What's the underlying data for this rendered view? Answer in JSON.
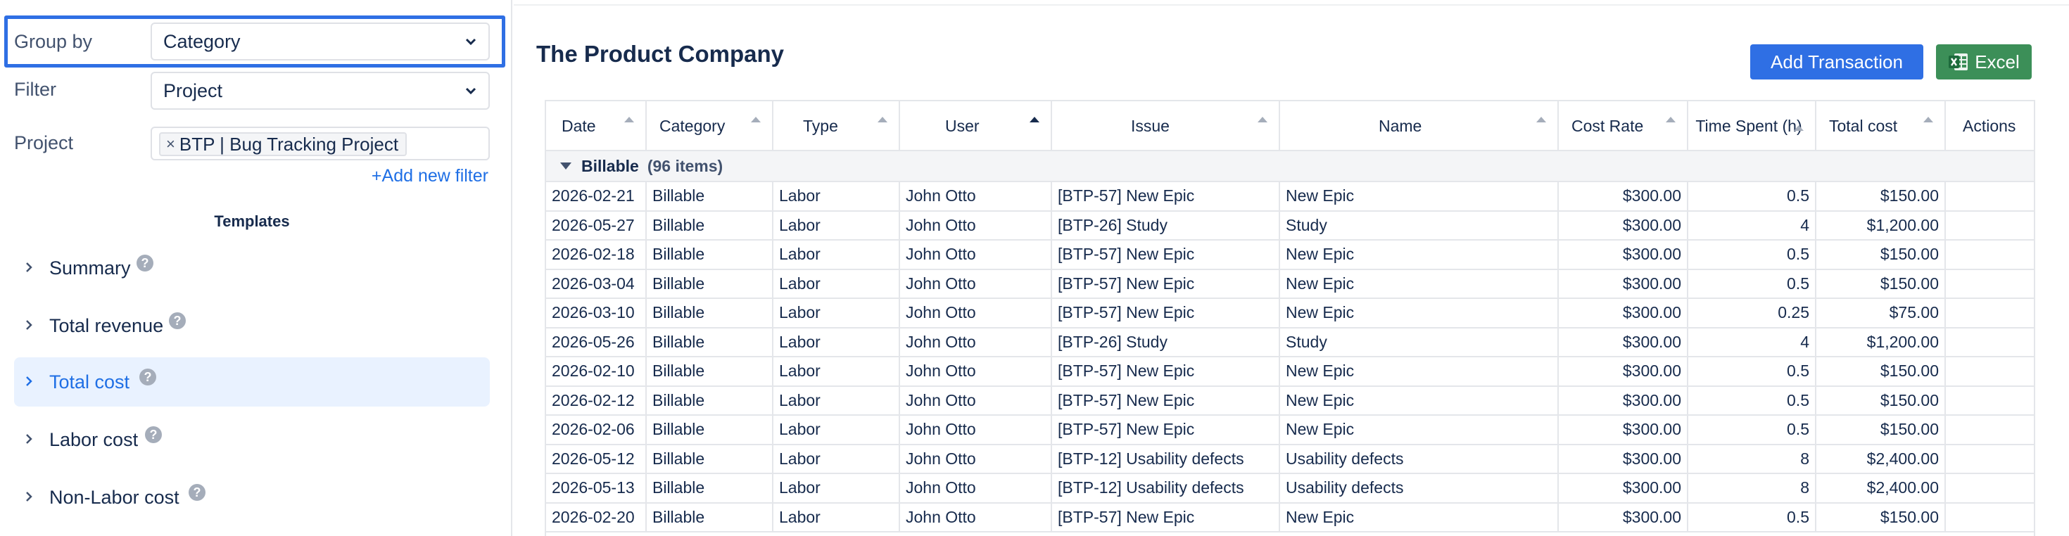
{
  "left": {
    "group_by": {
      "label": "Group by",
      "value": "Category"
    },
    "filter": {
      "label": "Filter",
      "value": "Project"
    },
    "project": {
      "label": "Project",
      "chip_remove": "×",
      "chip": "BTP | Bug Tracking Project"
    },
    "add_filter": "+Add new filter",
    "templates_title": "Templates",
    "templates": [
      {
        "label": "Summary",
        "active": false
      },
      {
        "label": "Total revenue",
        "active": false
      },
      {
        "label": "Total cost",
        "active": true
      },
      {
        "label": "Labor cost",
        "active": false
      },
      {
        "label": "Non-Labor cost",
        "active": false
      }
    ],
    "help_glyph": "?"
  },
  "right": {
    "company": "The Product Company",
    "add_button": "Add Transaction",
    "excel_button": "Excel",
    "columns": [
      {
        "label": "Date"
      },
      {
        "label": "Category"
      },
      {
        "label": "Type"
      },
      {
        "label": "User"
      },
      {
        "label": "Issue"
      },
      {
        "label": "Name"
      },
      {
        "label": "Cost Rate"
      },
      {
        "label": "Time Spent (h)"
      },
      {
        "label": "Total cost"
      },
      {
        "label": "Actions"
      }
    ],
    "group": {
      "name": "Billable",
      "count": "(96 items)"
    },
    "rows": [
      [
        "2026-02-21",
        "Billable",
        "Labor",
        "John Otto",
        "[BTP-57] New Epic",
        "New Epic",
        "$300.00",
        "0.5",
        "$150.00",
        ""
      ],
      [
        "2026-05-27",
        "Billable",
        "Labor",
        "John Otto",
        "[BTP-26] Study",
        "Study",
        "$300.00",
        "4",
        "$1,200.00",
        ""
      ],
      [
        "2026-02-18",
        "Billable",
        "Labor",
        "John Otto",
        "[BTP-57] New Epic",
        "New Epic",
        "$300.00",
        "0.5",
        "$150.00",
        ""
      ],
      [
        "2026-03-04",
        "Billable",
        "Labor",
        "John Otto",
        "[BTP-57] New Epic",
        "New Epic",
        "$300.00",
        "0.5",
        "$150.00",
        ""
      ],
      [
        "2026-03-10",
        "Billable",
        "Labor",
        "John Otto",
        "[BTP-57] New Epic",
        "New Epic",
        "$300.00",
        "0.25",
        "$75.00",
        ""
      ],
      [
        "2026-05-26",
        "Billable",
        "Labor",
        "John Otto",
        "[BTP-26] Study",
        "Study",
        "$300.00",
        "4",
        "$1,200.00",
        ""
      ],
      [
        "2026-02-10",
        "Billable",
        "Labor",
        "John Otto",
        "[BTP-57] New Epic",
        "New Epic",
        "$300.00",
        "0.5",
        "$150.00",
        ""
      ],
      [
        "2026-02-12",
        "Billable",
        "Labor",
        "John Otto",
        "[BTP-57] New Epic",
        "New Epic",
        "$300.00",
        "0.5",
        "$150.00",
        ""
      ],
      [
        "2026-02-06",
        "Billable",
        "Labor",
        "John Otto",
        "[BTP-57] New Epic",
        "New Epic",
        "$300.00",
        "0.5",
        "$150.00",
        ""
      ],
      [
        "2026-05-12",
        "Billable",
        "Labor",
        "John Otto",
        "[BTP-12] Usability defects",
        "Usability defects",
        "$300.00",
        "8",
        "$2,400.00",
        ""
      ],
      [
        "2026-05-13",
        "Billable",
        "Labor",
        "John Otto",
        "[BTP-12] Usability defects",
        "Usability defects",
        "$300.00",
        "8",
        "$2,400.00",
        ""
      ],
      [
        "2026-02-20",
        "Billable",
        "Labor",
        "John Otto",
        "[BTP-57] New Epic",
        "New Epic",
        "$300.00",
        "0.5",
        "$150.00",
        ""
      ]
    ]
  },
  "colors": {
    "accent": "#2f6fe4",
    "excel": "#3c8f58",
    "active_template_bg": "#e9f2ff",
    "link": "#1f6fe5"
  }
}
